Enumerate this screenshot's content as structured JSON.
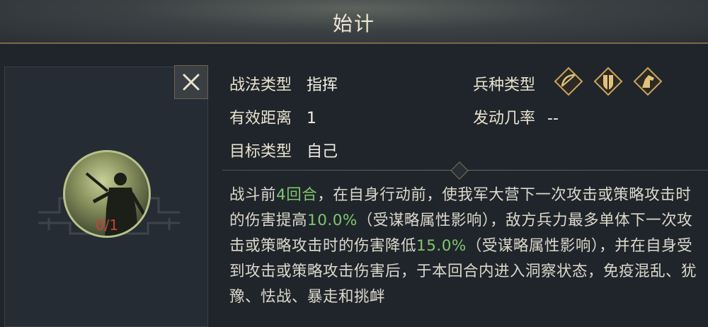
{
  "header": {
    "title": "始计"
  },
  "skill_info": {
    "type_label": "战法类型",
    "type_value": "指挥",
    "range_label": "有效距离",
    "range_value": "1",
    "target_label": "目标类型",
    "target_value": "自己",
    "troop_label": "兵种类型",
    "trigger_label": "发动几率",
    "trigger_value": "--"
  },
  "troop_icons": [
    "bow-cavalry-icon",
    "shield-infantry-icon",
    "horse-cavalry-icon"
  ],
  "portrait": {
    "count": "0/1"
  },
  "description": {
    "p1": "战斗前",
    "h1": "4回合",
    "p2": "，在自身行动前，使我军大营下一次攻击或策略攻击时的伤害提高",
    "h2": "10.0%",
    "p3": "（受谋略属性影响），敌方兵力最多单体下一次攻击或策略攻击时的伤害降低",
    "h3": "15.0%",
    "p4": "（受谋略属性影响），并在自身受到攻击或策略攻击伤害后，于本回合内进入洞察状态，免疫混乱、犹豫、怯战、暴走和挑衅"
  },
  "colors": {
    "highlight": "#7fc76d",
    "count": "#c9403a",
    "gold": "#c9a45a"
  }
}
